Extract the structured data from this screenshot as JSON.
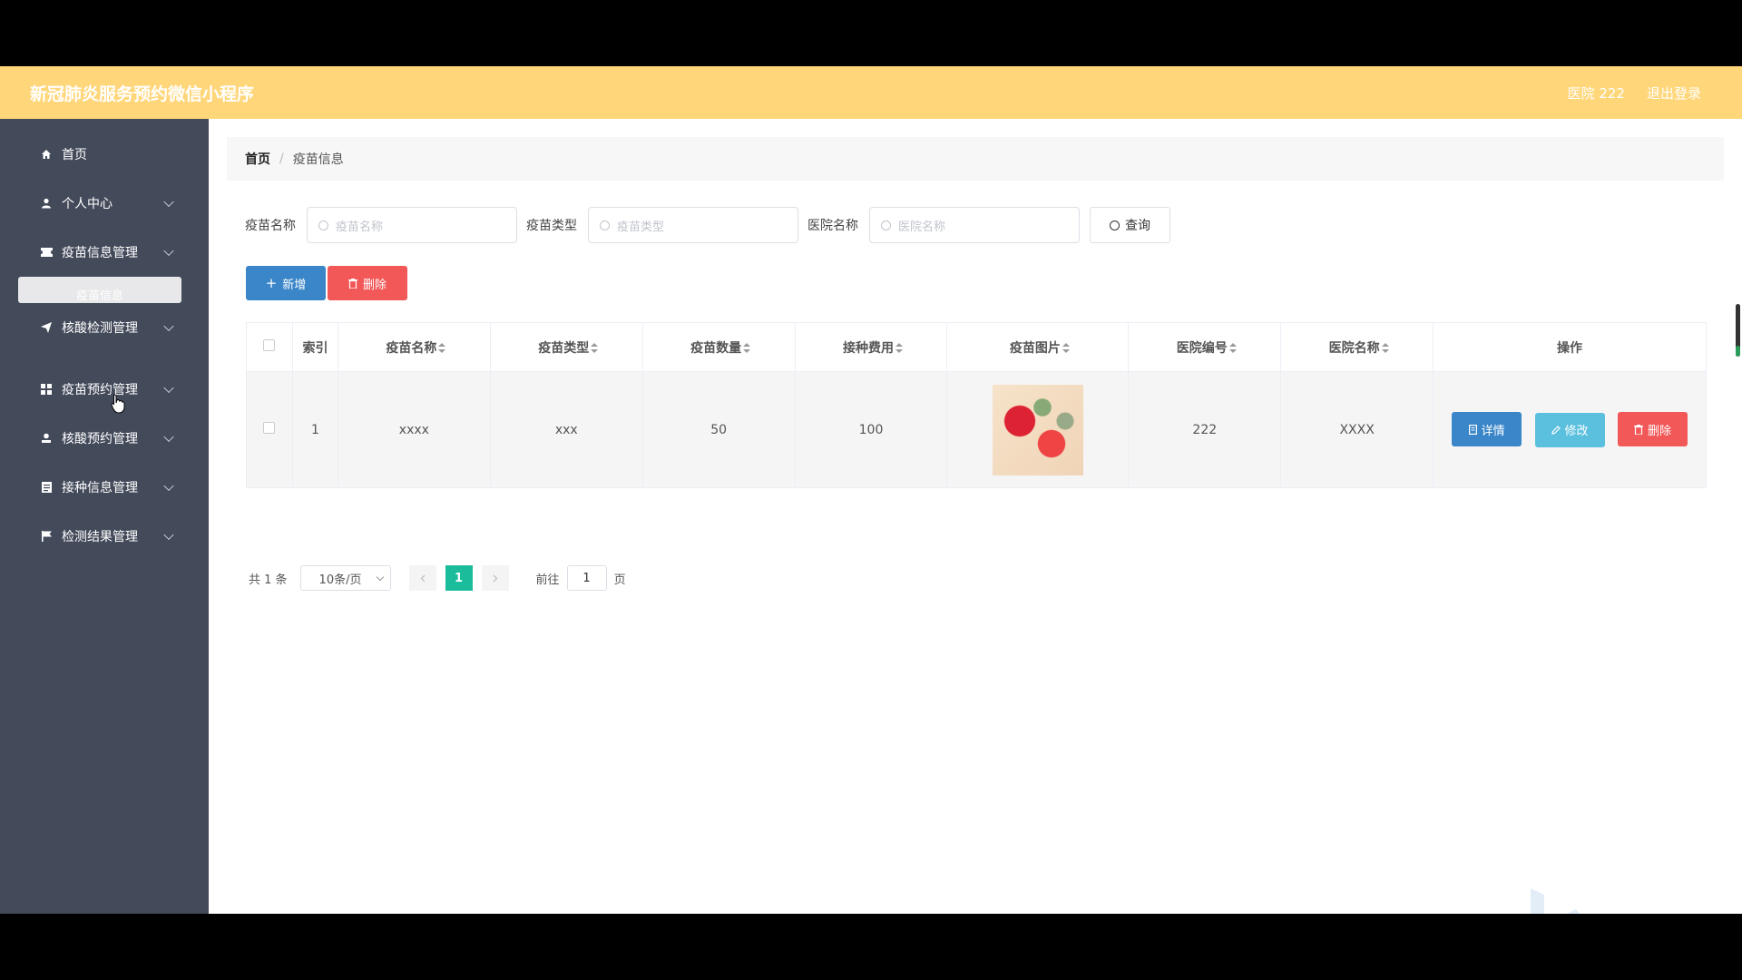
{
  "app": {
    "title": "新冠肺炎服务预约微信小程序",
    "user": "医院 222",
    "logout": "退出登录"
  },
  "sidebar": {
    "items": [
      {
        "label": "首页",
        "icon": "home-icon"
      },
      {
        "label": "个人中心",
        "icon": "user-icon"
      },
      {
        "label": "疫苗信息管理",
        "icon": "ticket-icon"
      },
      {
        "label": "核酸检测管理",
        "icon": "send-icon"
      },
      {
        "label": "疫苗预约管理",
        "icon": "grid-icon"
      },
      {
        "label": "核酸预约管理",
        "icon": "user-stamp-icon"
      },
      {
        "label": "接种信息管理",
        "icon": "document-icon"
      },
      {
        "label": "检测结果管理",
        "icon": "flag-icon"
      }
    ],
    "submenu_active": "疫苗信息"
  },
  "breadcrumb": {
    "home": "首页",
    "separator": "/",
    "current": "疫苗信息"
  },
  "search": {
    "fields": [
      {
        "label": "疫苗名称",
        "placeholder": "疫苗名称"
      },
      {
        "label": "疫苗类型",
        "placeholder": "疫苗类型"
      },
      {
        "label": "医院名称",
        "placeholder": "医院名称"
      }
    ],
    "query_label": "查询"
  },
  "actions": {
    "add_label": "新增",
    "delete_label": "删除"
  },
  "table": {
    "columns": [
      "索引",
      "疫苗名称",
      "疫苗类型",
      "疫苗数量",
      "接种费用",
      "疫苗图片",
      "医院编号",
      "医院名称",
      "操作"
    ],
    "rows": [
      {
        "index": "1",
        "name": "xxxx",
        "type": "xxx",
        "quantity": "50",
        "fee": "100",
        "hospital_no": "222",
        "hospital_name": "XXXX"
      }
    ],
    "row_buttons": {
      "detail": "详情",
      "edit": "修改",
      "remove": "删除"
    }
  },
  "pagination": {
    "total": "共 1 条",
    "page_size": "10条/页",
    "current_page": "1",
    "goto_prefix": "前往",
    "goto_value": "1",
    "goto_suffix": "页"
  },
  "colors": {
    "topbar": "#ffd67a",
    "sidebar": "#434a5a",
    "primary": "#3a86c8",
    "danger": "#f25858",
    "info": "#5bc0de",
    "pager_active": "#1abc9c"
  }
}
